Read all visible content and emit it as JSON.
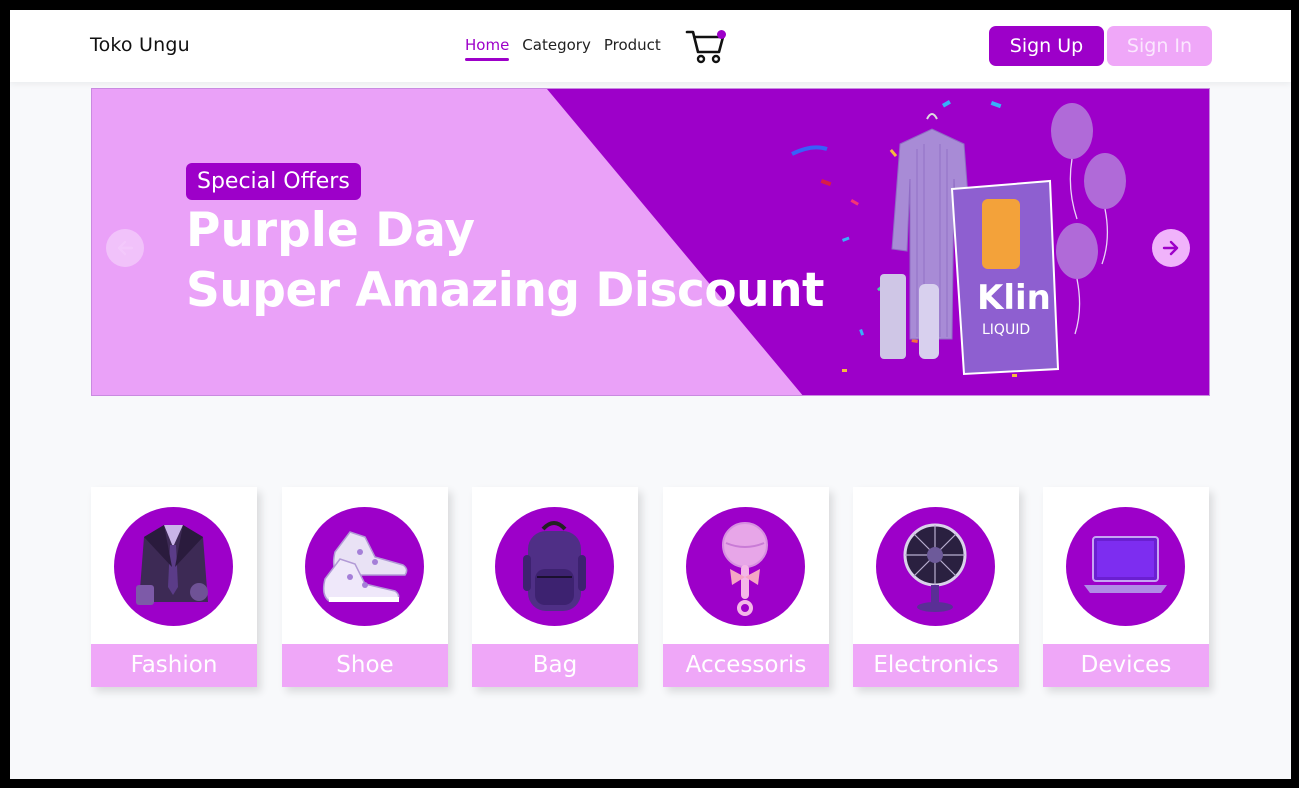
{
  "header": {
    "brand": "Toko Ungu",
    "nav": [
      {
        "label": "Home",
        "active": true
      },
      {
        "label": "Category",
        "active": false
      },
      {
        "label": "Product",
        "active": false
      }
    ],
    "cart_icon": "shopping-cart-icon",
    "signup_label": "Sign Up",
    "signin_label": "Sign In"
  },
  "banner": {
    "badge": "Special Offers",
    "headline_line1": "Purple Day",
    "headline_line2": "Super Amazing Discount",
    "prev_icon": "arrow-left-icon",
    "next_icon": "arrow-right-icon",
    "product_pouch_text": "Klin",
    "product_pouch_sub": "LIQUID"
  },
  "categories": [
    {
      "label": "Fashion",
      "icon": "suit-icon"
    },
    {
      "label": "Shoe",
      "icon": "sneaker-icon"
    },
    {
      "label": "Bag",
      "icon": "backpack-icon"
    },
    {
      "label": "Accessoris",
      "icon": "rattle-icon"
    },
    {
      "label": "Electronics",
      "icon": "fan-icon"
    },
    {
      "label": "Devices",
      "icon": "laptop-icon"
    }
  ],
  "colors": {
    "primary": "#9d00c9",
    "light": "#efa7f8",
    "banner_light": "#eaa1f8",
    "page_bg": "#f8f9fb"
  }
}
